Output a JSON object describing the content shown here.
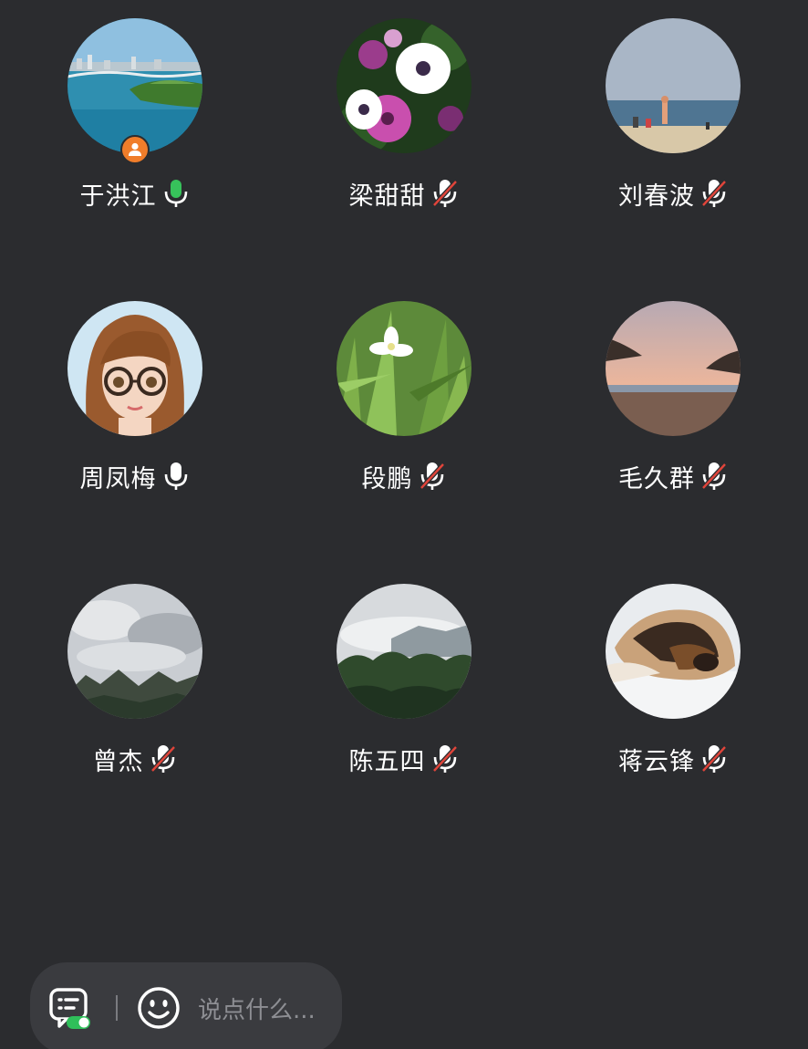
{
  "members": [
    {
      "name": "于洪江",
      "mic": "on",
      "host": true,
      "avatar": "lake-city-photo"
    },
    {
      "name": "梁甜甜",
      "mic": "off",
      "host": false,
      "avatar": "pink-white-flowers-photo"
    },
    {
      "name": "刘春波",
      "mic": "off",
      "host": false,
      "avatar": "beach-people-photo"
    },
    {
      "name": "周凤梅",
      "mic": "on",
      "host": false,
      "avatar": "cartoon-girl-glasses"
    },
    {
      "name": "段鹏",
      "mic": "off",
      "host": false,
      "avatar": "white-flower-grass-photo"
    },
    {
      "name": "毛久群",
      "mic": "off",
      "host": false,
      "avatar": "sunset-beach-photo"
    },
    {
      "name": "曾杰",
      "mic": "off",
      "host": false,
      "avatar": "cloudy-mountains-photo"
    },
    {
      "name": "陈五四",
      "mic": "off",
      "host": false,
      "avatar": "misty-forest-photo"
    },
    {
      "name": "蒋云锋",
      "mic": "off",
      "host": false,
      "avatar": "sleeping-dog-photo"
    }
  ],
  "input": {
    "placeholder": "说点什么..."
  },
  "icons": {
    "host_badge": "person-icon",
    "mic_on": "mic-on-icon",
    "mic_off": "mic-off-icon",
    "chat_toggle": "chat-toggle-icon",
    "emoji": "emoji-icon"
  },
  "colors": {
    "background": "#2b2c2f",
    "mic_on": "#37c25b",
    "mic_off_slash": "#e0443a",
    "host_badge": "#f07d2a",
    "toggle_on": "#2fbf5a"
  }
}
